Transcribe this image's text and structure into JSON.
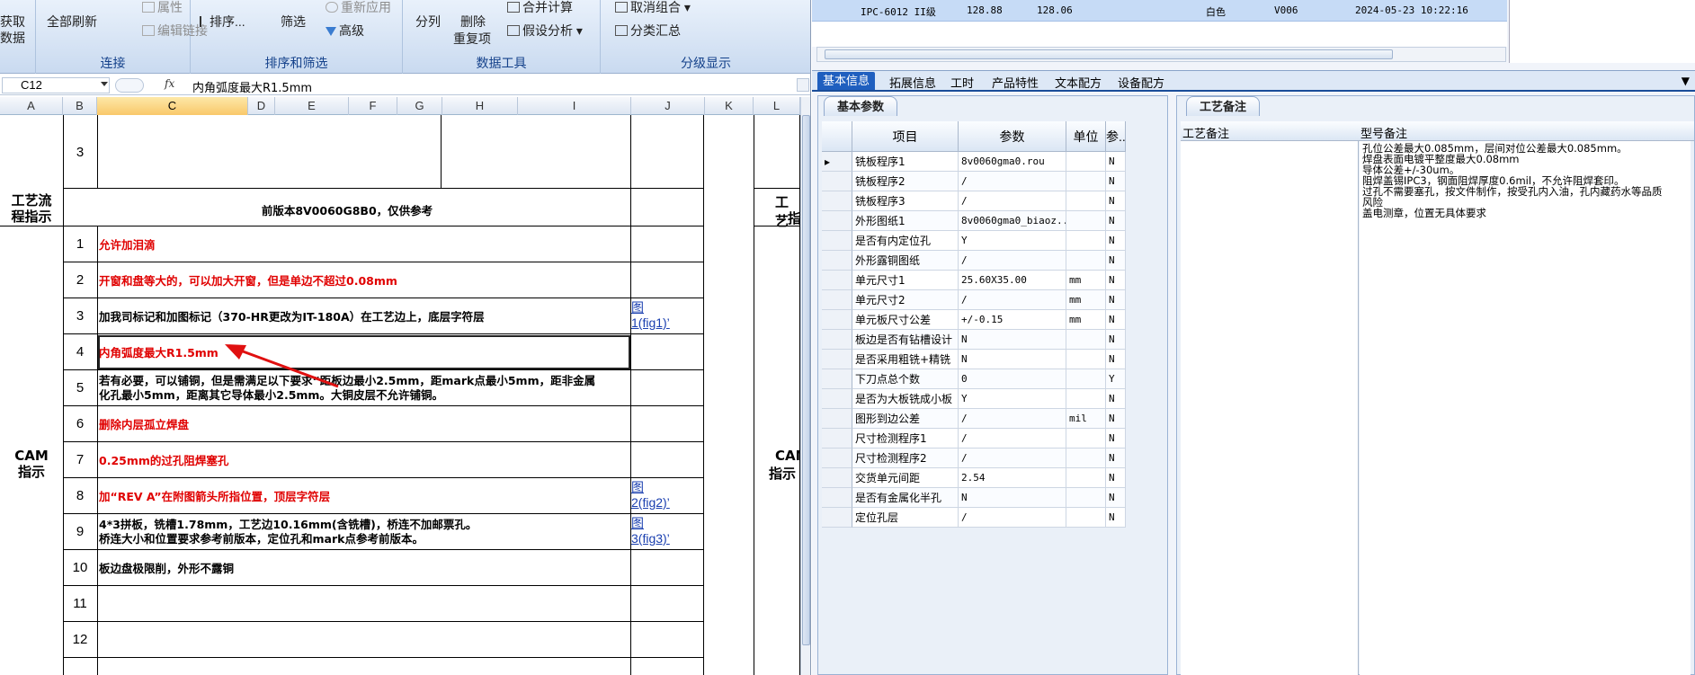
{
  "ribbon": {
    "get_data_label": "获取",
    "get_data_label2": "数据",
    "refresh_all_label": "全部刷新",
    "properties_label": "属性",
    "edit_links_label": "编辑链接",
    "group_connections": "连接",
    "sort_label": "排序...",
    "filter_label": "筛选",
    "reapply_label": "重新应用",
    "advanced_label": "高级",
    "group_sort_filter": "排序和筛选",
    "text_to_columns_label": "分列",
    "remove_duplicates_label": "删除",
    "remove_duplicates_label2": "重复项",
    "consolidate_label": "合并计算",
    "whatif_label": "假设分析",
    "group_data_tools": "数据工具",
    "ungroup_label": "取消组合",
    "subtotal_label": "分类汇总",
    "group_outline": "分级显示"
  },
  "formula_bar": {
    "name_box": "C12",
    "fx": "fx",
    "content": "内角弧度最大R1.5mm"
  },
  "columns": [
    "A",
    "B",
    "C",
    "D",
    "E",
    "F",
    "G",
    "H",
    "I",
    "J",
    "K",
    "L"
  ],
  "sheet": {
    "row3_num": "3",
    "section_process": "工艺流程指示",
    "process_note": "前版本8V0060G8B0，仅供参考",
    "section_cam": "CAM指示",
    "right_section_process": "工艺",
    "right_section_process2": "指",
    "right_section_cam": "CAM",
    "right_section_cam2": "指示",
    "rows": [
      {
        "num": "1",
        "text": "允许加泪滴",
        "link": ""
      },
      {
        "num": "2",
        "text": "开窗和盘等大的，可以加大开窗，但是单边不超过0.08mm",
        "link": ""
      },
      {
        "num": "3",
        "text": "加我司标记和加图标记（370-HR更改为IT-180A）在工艺边上，底层字符层",
        "link": "图",
        "link2": "1(fig1)’"
      },
      {
        "num": "4",
        "text": "内角弧度最大R1.5mm",
        "link": ""
      },
      {
        "num": "5",
        "text": "若有必要，可以铺铜，但是需满足以下要求“距板边最小2.5mm，距mark点最小5mm，距非金属",
        "text2": "化孔最小5mm，距离其它导体最小2.5mm。大铜皮层不允许铺铜。",
        "link": ""
      },
      {
        "num": "6",
        "text": "删除内层孤立焊盘",
        "link": ""
      },
      {
        "num": "7",
        "text": "0.25mm的过孔阻焊塞孔",
        "link": ""
      },
      {
        "num": "8",
        "text": "加“REV A”在附图箭头所指位置，顶层字符层",
        "link": "图",
        "link2": "2(fig2)’"
      },
      {
        "num": "9",
        "text": "4*3拼板，铣槽1.78mm，工艺边10.16mm(含铣槽)，桥连不加邮票孔。",
        "text2": "桥连大小和位置要求参考前版本，定位孔和mark点参考前版本。",
        "link": "图",
        "link2": "3(fig3)’"
      },
      {
        "num": "10",
        "text": "板边盘极限削，外形不露铜",
        "link": ""
      },
      {
        "num": "11",
        "text": "",
        "link": ""
      },
      {
        "num": "12",
        "text": "",
        "link": ""
      }
    ]
  },
  "erp": {
    "top_row": {
      "model": "IPC-6012 II级",
      "v1": "128.88",
      "v2": "128.06",
      "color": "白色",
      "code": "V006",
      "time": "2024-05-23 10:22:16"
    },
    "tabs": [
      "基本信息",
      "拓展信息",
      "工时",
      "产品特性",
      "文本配方",
      "设备配方"
    ],
    "panel1_title": "基本参数",
    "panel2_title": "工艺备注",
    "table_headers": [
      "项目",
      "参数",
      "单位",
      "参.."
    ],
    "table_rows": [
      {
        "item": "铣板程序1",
        "param": "8v0060gma0.rou",
        "unit": "",
        "flag": "N"
      },
      {
        "item": "铣板程序2",
        "param": "/",
        "unit": "",
        "flag": "N"
      },
      {
        "item": "铣板程序3",
        "param": "/",
        "unit": "",
        "flag": "N"
      },
      {
        "item": "外形图纸1",
        "param": "8v0060gma0_biaoz...",
        "unit": "",
        "flag": "N"
      },
      {
        "item": "是否有内定位孔",
        "param": "Y",
        "unit": "",
        "flag": "N"
      },
      {
        "item": "外形露铜图纸",
        "param": "/",
        "unit": "",
        "flag": "N"
      },
      {
        "item": "单元尺寸1",
        "param": "25.60X35.00",
        "unit": "mm",
        "flag": "N"
      },
      {
        "item": "单元尺寸2",
        "param": "/",
        "unit": "mm",
        "flag": "N"
      },
      {
        "item": "单元板尺寸公差",
        "param": "+/-0.15",
        "unit": "mm",
        "flag": "N"
      },
      {
        "item": "板边是否有钻槽设计",
        "param": "N",
        "unit": "",
        "flag": "N"
      },
      {
        "item": "是否采用粗铣+精铣",
        "param": "N",
        "unit": "",
        "flag": "N"
      },
      {
        "item": "下刀点总个数",
        "param": "0",
        "unit": "",
        "flag": "Y"
      },
      {
        "item": "是否为大板铣成小板",
        "param": "Y",
        "unit": "",
        "flag": "N"
      },
      {
        "item": "图形到边公差",
        "param": "/",
        "unit": "mil",
        "flag": "N"
      },
      {
        "item": "尺寸检测程序1",
        "param": "/",
        "unit": "",
        "flag": "N"
      },
      {
        "item": "尺寸检测程序2",
        "param": "/",
        "unit": "",
        "flag": "N"
      },
      {
        "item": "交货单元间距",
        "param": "2.54",
        "unit": "",
        "flag": "N"
      },
      {
        "item": "是否有金属化半孔",
        "param": "N",
        "unit": "",
        "flag": "N"
      },
      {
        "item": "定位孔层",
        "param": "/",
        "unit": "",
        "flag": "N"
      }
    ],
    "remark_headers": [
      "工艺备注",
      "型号备注"
    ],
    "model_remarks": [
      "孔位公差最大0.085mm，层间对位公差最大0.085mm。",
      "焊盘表面电镀平整度最大0.08mm",
      "导体公差+/-30um。",
      "阻焊盖锡IPC3，钢面阻焊厚度0.6mil，不允许阻焊套印。",
      "过孔不需要塞孔，按文件制作，按受孔内入油，孔内藏药水等品质",
      "风险",
      "盖电测章，位置无具体要求"
    ]
  }
}
